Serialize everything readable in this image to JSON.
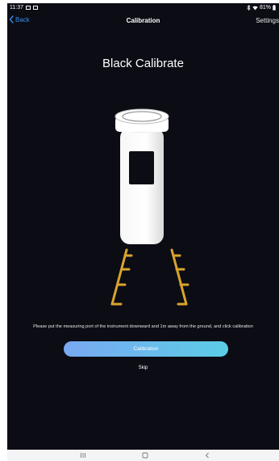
{
  "status_bar": {
    "time": "11:37",
    "battery": "81%"
  },
  "nav": {
    "back_label": "Back",
    "title": "Calibration",
    "settings_label": "Settings"
  },
  "main": {
    "title": "Black Calibrate",
    "instruction": "Please put the measuring port of the instrument downward and 1m away from the ground, and click calibration",
    "calibrate_button": "Calibration",
    "skip_label": "Skip"
  },
  "colors": {
    "background": "#0b0c14",
    "accent_blue": "#3a8ee8",
    "button_gradient_start": "#79a9f3",
    "button_gradient_end": "#5bcde4",
    "tripod_legs": "#d9a42b"
  },
  "icons": {
    "back": "chevron-left-icon",
    "android_recent": "recent-apps-icon",
    "android_home": "home-icon",
    "android_back": "back-arrow-icon"
  }
}
